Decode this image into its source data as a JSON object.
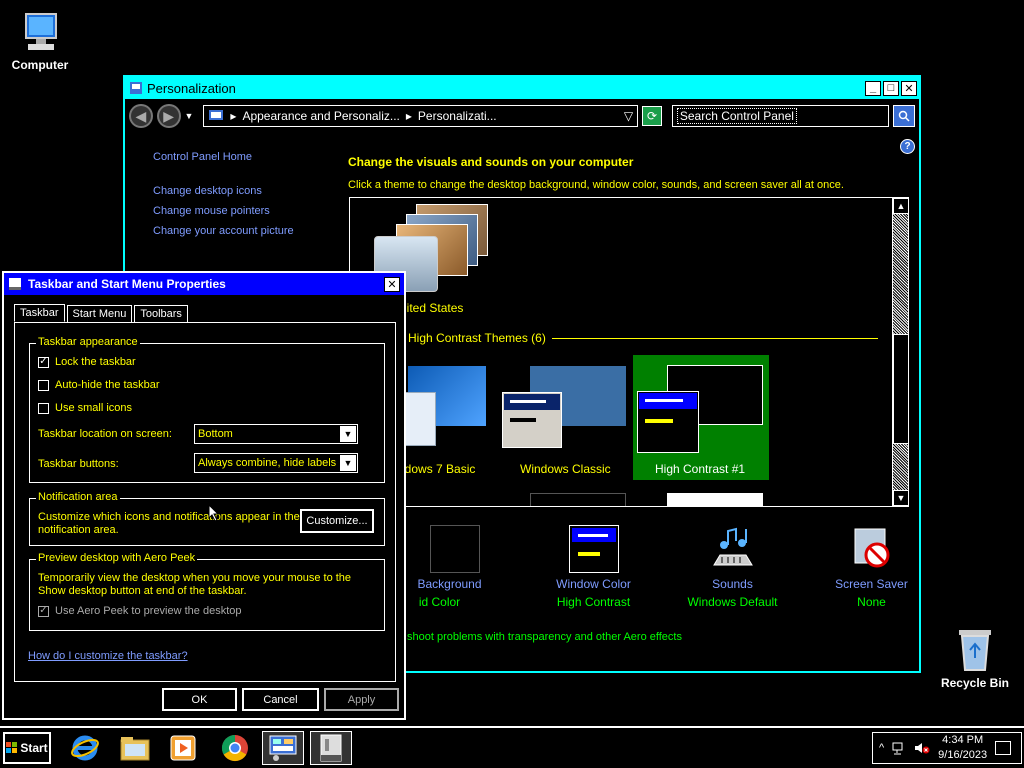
{
  "desktop": {
    "computer_label": "Computer",
    "recycle_label": "Recycle Bin"
  },
  "personalization": {
    "title": "Personalization",
    "min_glyph": "_",
    "max_glyph": "□",
    "close_glyph": "✕",
    "back_glyph": "◀",
    "fwd_glyph": "▶",
    "breadcrumb_1": "Appearance and Personaliz...",
    "breadcrumb_2": "Personalizati...",
    "crumb_sep": "▸",
    "dropdown_glyph": "▽",
    "search_placeholder": "Search Control Panel",
    "help_glyph": "?",
    "left_links": [
      "Control Panel Home",
      "Change desktop icons",
      "Change mouse pointers",
      "Change your account picture"
    ],
    "heading": "Change the visuals and sounds on your computer",
    "subtext": "Click a theme to change the desktop background, window color, sounds, and screen saver all at once.",
    "theme_united_states": "nited States",
    "group_header": "d High Contrast Themes (6)",
    "themes": [
      "ndows 7 Basic",
      "Windows Classic",
      "High Contrast #1"
    ],
    "bottom": [
      {
        "name": "Background",
        "value": "id Color"
      },
      {
        "name": "Window Color",
        "value": "High Contrast"
      },
      {
        "name": "Sounds",
        "value": "Windows Default"
      },
      {
        "name": "Screen Saver",
        "value": "None"
      }
    ],
    "troubleshoot": "shoot problems with transparency and other Aero effects",
    "scroll_up": "▲",
    "scroll_down": "▼"
  },
  "dialog": {
    "title": "Taskbar and Start Menu Properties",
    "close_glyph": "✕",
    "tabs": [
      "Taskbar",
      "Start Menu",
      "Toolbars"
    ],
    "appearance": {
      "title": "Taskbar appearance",
      "lock": "Lock the taskbar",
      "autohide": "Auto-hide the taskbar",
      "small_icons": "Use small icons",
      "location_label": "Taskbar location on screen:",
      "location_value": "Bottom",
      "buttons_label": "Taskbar buttons:",
      "buttons_value": "Always combine, hide labels",
      "check_glyph": "✓",
      "dd_glyph": "▼"
    },
    "notification": {
      "title": "Notification area",
      "text": "Customize which icons and notifications appear in the notification area.",
      "customize": "Customize..."
    },
    "peek": {
      "title": "Preview desktop with Aero Peek",
      "text": "Temporarily view the desktop when you move your mouse to the Show desktop button at end of the taskbar.",
      "checkbox": "Use Aero Peek to preview the desktop"
    },
    "help_link": "How do I customize the taskbar?",
    "ok": "OK",
    "cancel": "Cancel",
    "apply": "Apply"
  },
  "taskbar": {
    "start": "Start",
    "time": "4:34 PM",
    "date": "9/16/2023",
    "tray_up": "^"
  }
}
